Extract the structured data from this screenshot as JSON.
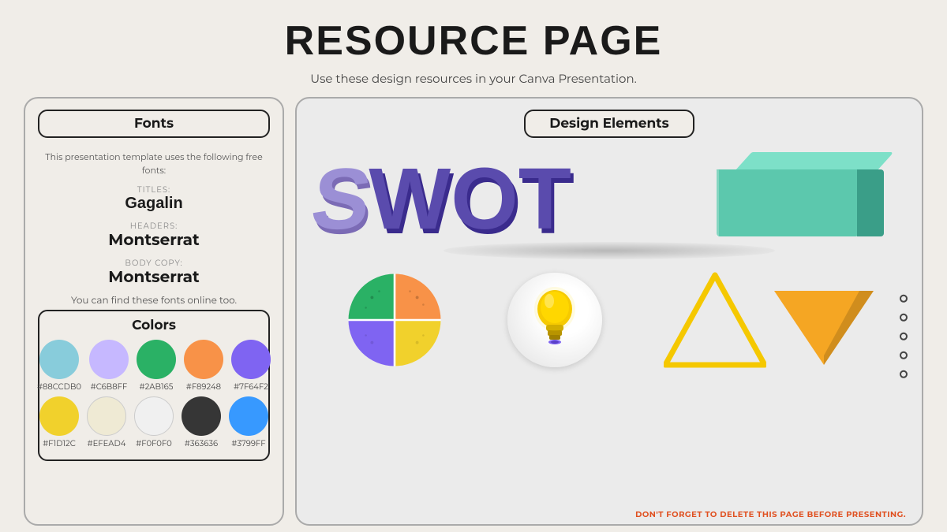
{
  "page": {
    "title": "RESOURCE PAGE",
    "subtitle": "Use these design resources in your Canva Presentation.",
    "footer_note": "DON'T FORGET TO DELETE THIS PAGE BEFORE PRESENTING."
  },
  "left_panel": {
    "fonts_title": "Fonts",
    "fonts_desc": "This presentation template uses the following free fonts:",
    "title_label": "TITLES:",
    "title_font": "Gagalin",
    "headers_label": "HEADERS:",
    "headers_font": "Montserrat",
    "body_label": "BODY COPY:",
    "body_font": "Montserrat",
    "find_text": "You can find these fonts online too.",
    "colors_title": "Colors",
    "colors": [
      {
        "hex": "#88CCDB",
        "label": "#88CCDB0"
      },
      {
        "hex": "#C6B8FF",
        "label": "#C6B8FF"
      },
      {
        "hex": "#2AB165",
        "label": "#2AB165"
      },
      {
        "hex": "#F89248",
        "label": "#F89248"
      },
      {
        "hex": "#7F64F2",
        "label": "#7F64F2"
      },
      {
        "hex": "#F1D12C",
        "label": "#F1D12C"
      },
      {
        "hex": "#EFEAD4",
        "label": "#EFEAD4"
      },
      {
        "hex": "#F0F0F0",
        "label": "#F0F0F0"
      },
      {
        "hex": "#363636",
        "label": "#363636"
      },
      {
        "hex": "#3799FF",
        "label": "#3799FF"
      }
    ]
  },
  "right_panel": {
    "badge": "Design Elements",
    "swot_letters": [
      "S",
      "W",
      "O",
      "T"
    ],
    "dots_count": 5
  }
}
